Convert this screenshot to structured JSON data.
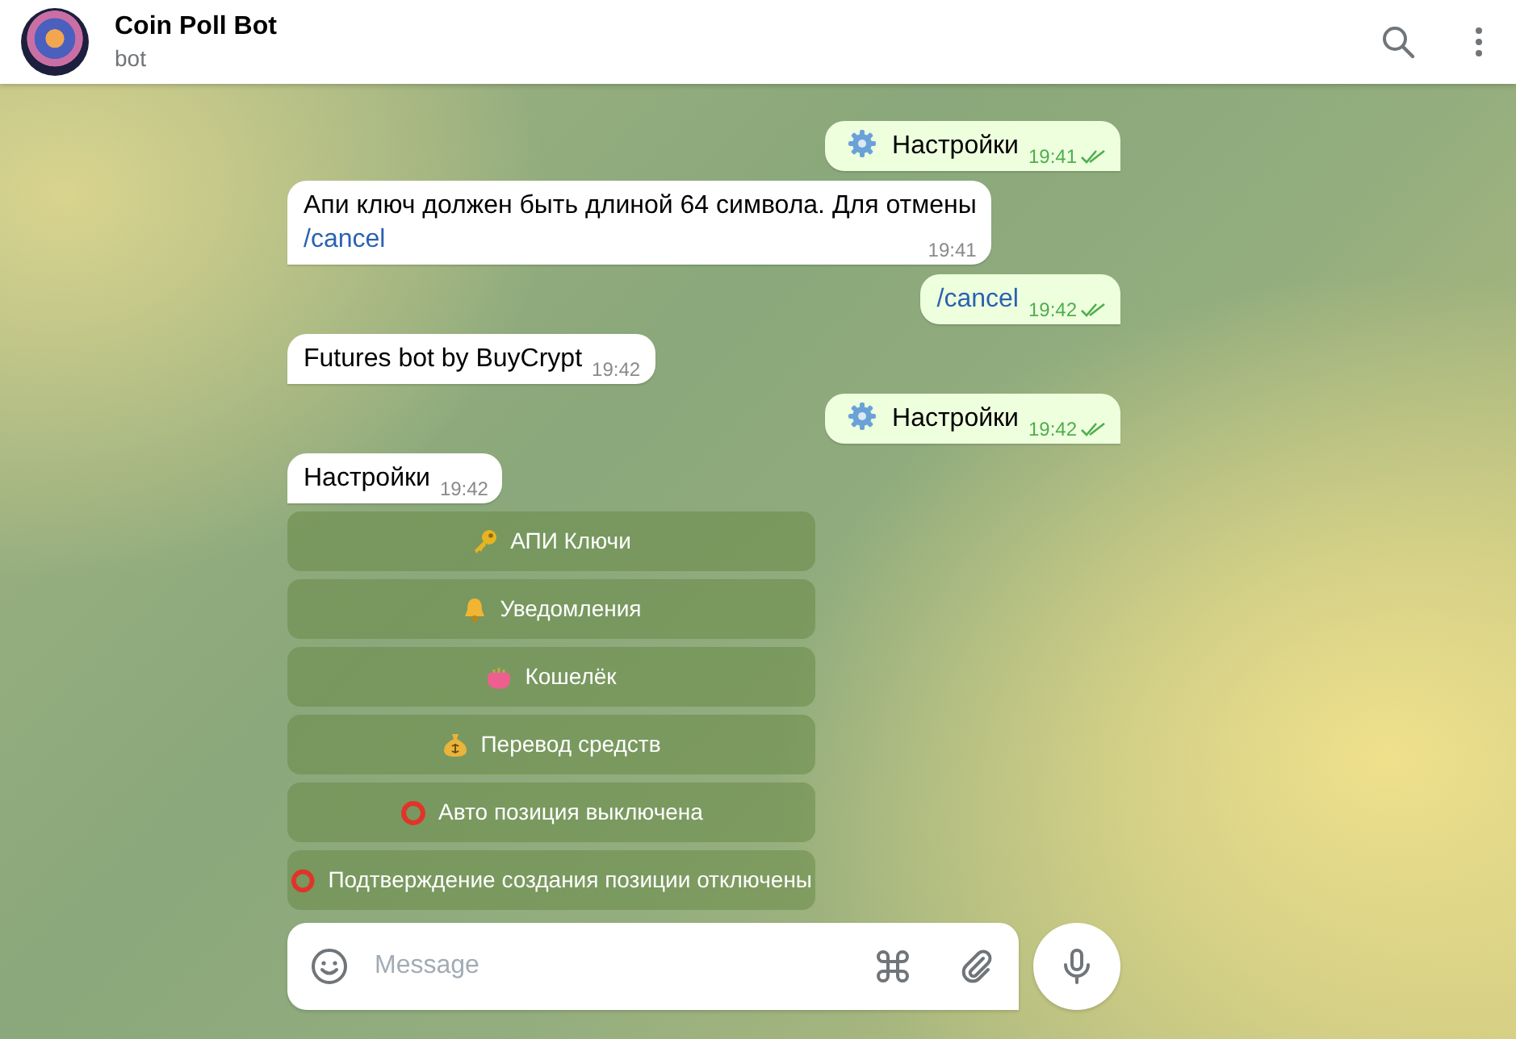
{
  "header": {
    "title": "Coin Poll Bot",
    "subtitle": "bot"
  },
  "messages": [
    {
      "kind": "outgoing-settings",
      "text": "Настройки",
      "time": "19:41",
      "read": true
    },
    {
      "kind": "incoming",
      "text": "Апи ключ должен быть длиной 64 символа. Для отмены",
      "command": "/cancel",
      "time": "19:41"
    },
    {
      "kind": "outgoing",
      "command": "/cancel",
      "time": "19:42",
      "read": true
    },
    {
      "kind": "incoming",
      "text": "Futures bot by BuyCrypt",
      "time": "19:42"
    },
    {
      "kind": "outgoing-settings",
      "text": "Настройки",
      "time": "19:42",
      "read": true
    },
    {
      "kind": "incoming",
      "text": "Настройки",
      "time": "19:42",
      "keyboard": [
        {
          "kind": "key",
          "label": "АПИ Ключи"
        },
        {
          "kind": "bell",
          "label": "Уведомления"
        },
        {
          "kind": "purse",
          "label": "Кошелёк"
        },
        {
          "kind": "moneybag",
          "label": "Перевод средств"
        },
        {
          "kind": "ring",
          "label": "Авто позиция выключена"
        },
        {
          "kind": "ring",
          "label": "Подтверждение создания позиции отключены"
        }
      ]
    }
  ],
  "composer": {
    "placeholder": "Message"
  }
}
